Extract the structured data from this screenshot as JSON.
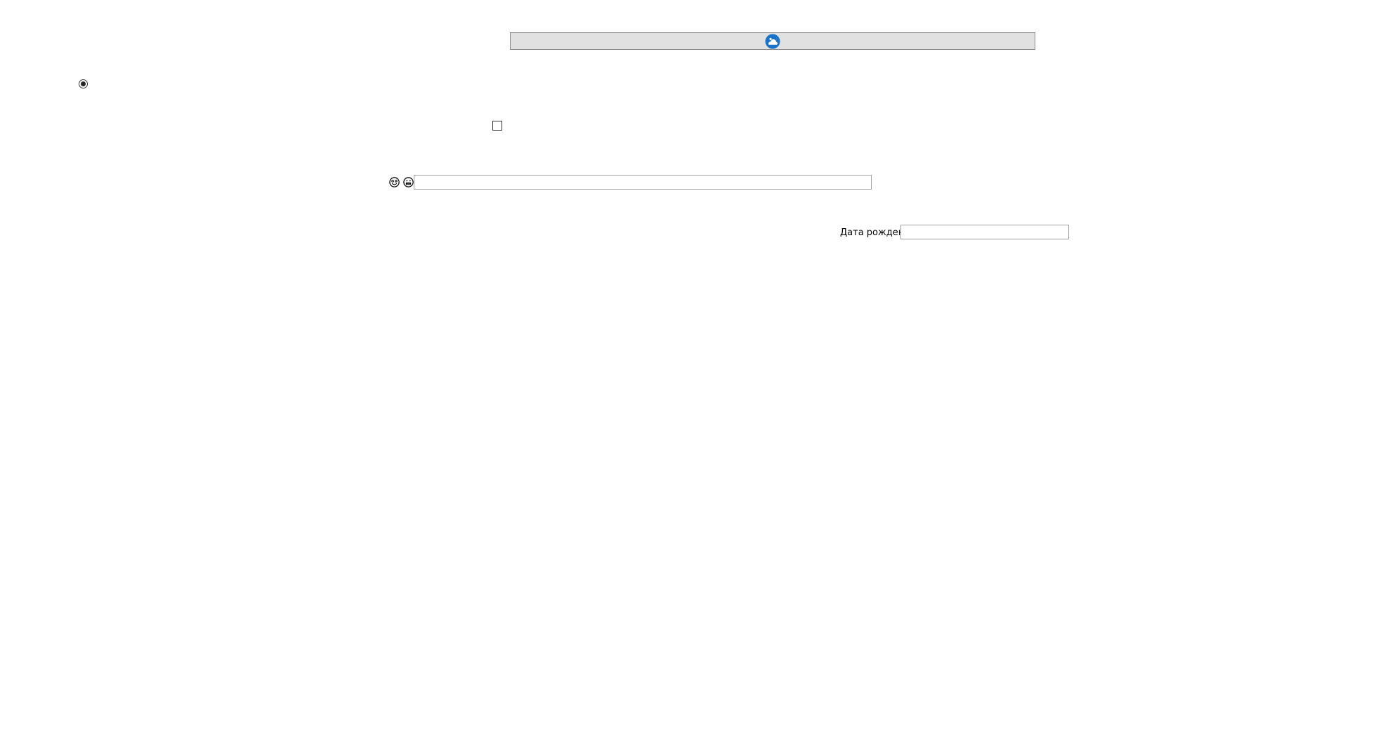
{
  "top_button": {
    "icon": "cloud-logo-icon",
    "accent_color": "#1a73c8"
  },
  "radio": {
    "checked": true
  },
  "checkbox": {
    "checked": false
  },
  "icons": {
    "first": "smiley-face-icon",
    "second": "grinning-face-icon"
  },
  "text_field": {
    "value": "",
    "placeholder": ""
  },
  "birth_date": {
    "label": "Дата рождения",
    "value": "",
    "placeholder": ""
  }
}
